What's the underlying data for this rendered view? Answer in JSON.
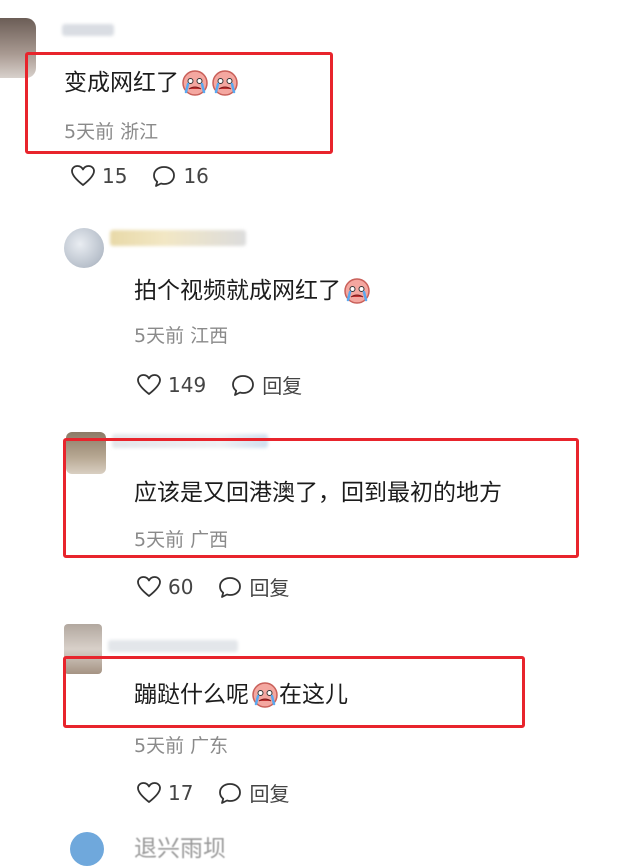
{
  "comments": [
    {
      "text": "变成网红了",
      "time": "5天前",
      "location": "浙江",
      "likes": "15",
      "replies": "16",
      "emoji_count": 2
    },
    {
      "text": "拍个视频就成网红了",
      "time": "5天前",
      "location": "江西",
      "likes": "149",
      "reply_label": "回复",
      "emoji_count": 1
    },
    {
      "text": "应该是又回港澳了，回到最初的地方",
      "time": "5天前",
      "location": "广西",
      "likes": "60",
      "reply_label": "回复"
    },
    {
      "text_before": "蹦跶什么呢",
      "text_after": "在这儿",
      "time": "5天前",
      "location": "广东",
      "likes": "17",
      "reply_label": "回复",
      "emoji_count": 1
    }
  ],
  "bottom_preview_text": "退兴雨坝",
  "colors": {
    "highlight_box": "#e8242c",
    "meta_text": "#8a8a8a",
    "background": "#ffffff"
  },
  "icons": [
    "heart-icon",
    "comment-bubble-icon",
    "crying-emoji-icon"
  ]
}
